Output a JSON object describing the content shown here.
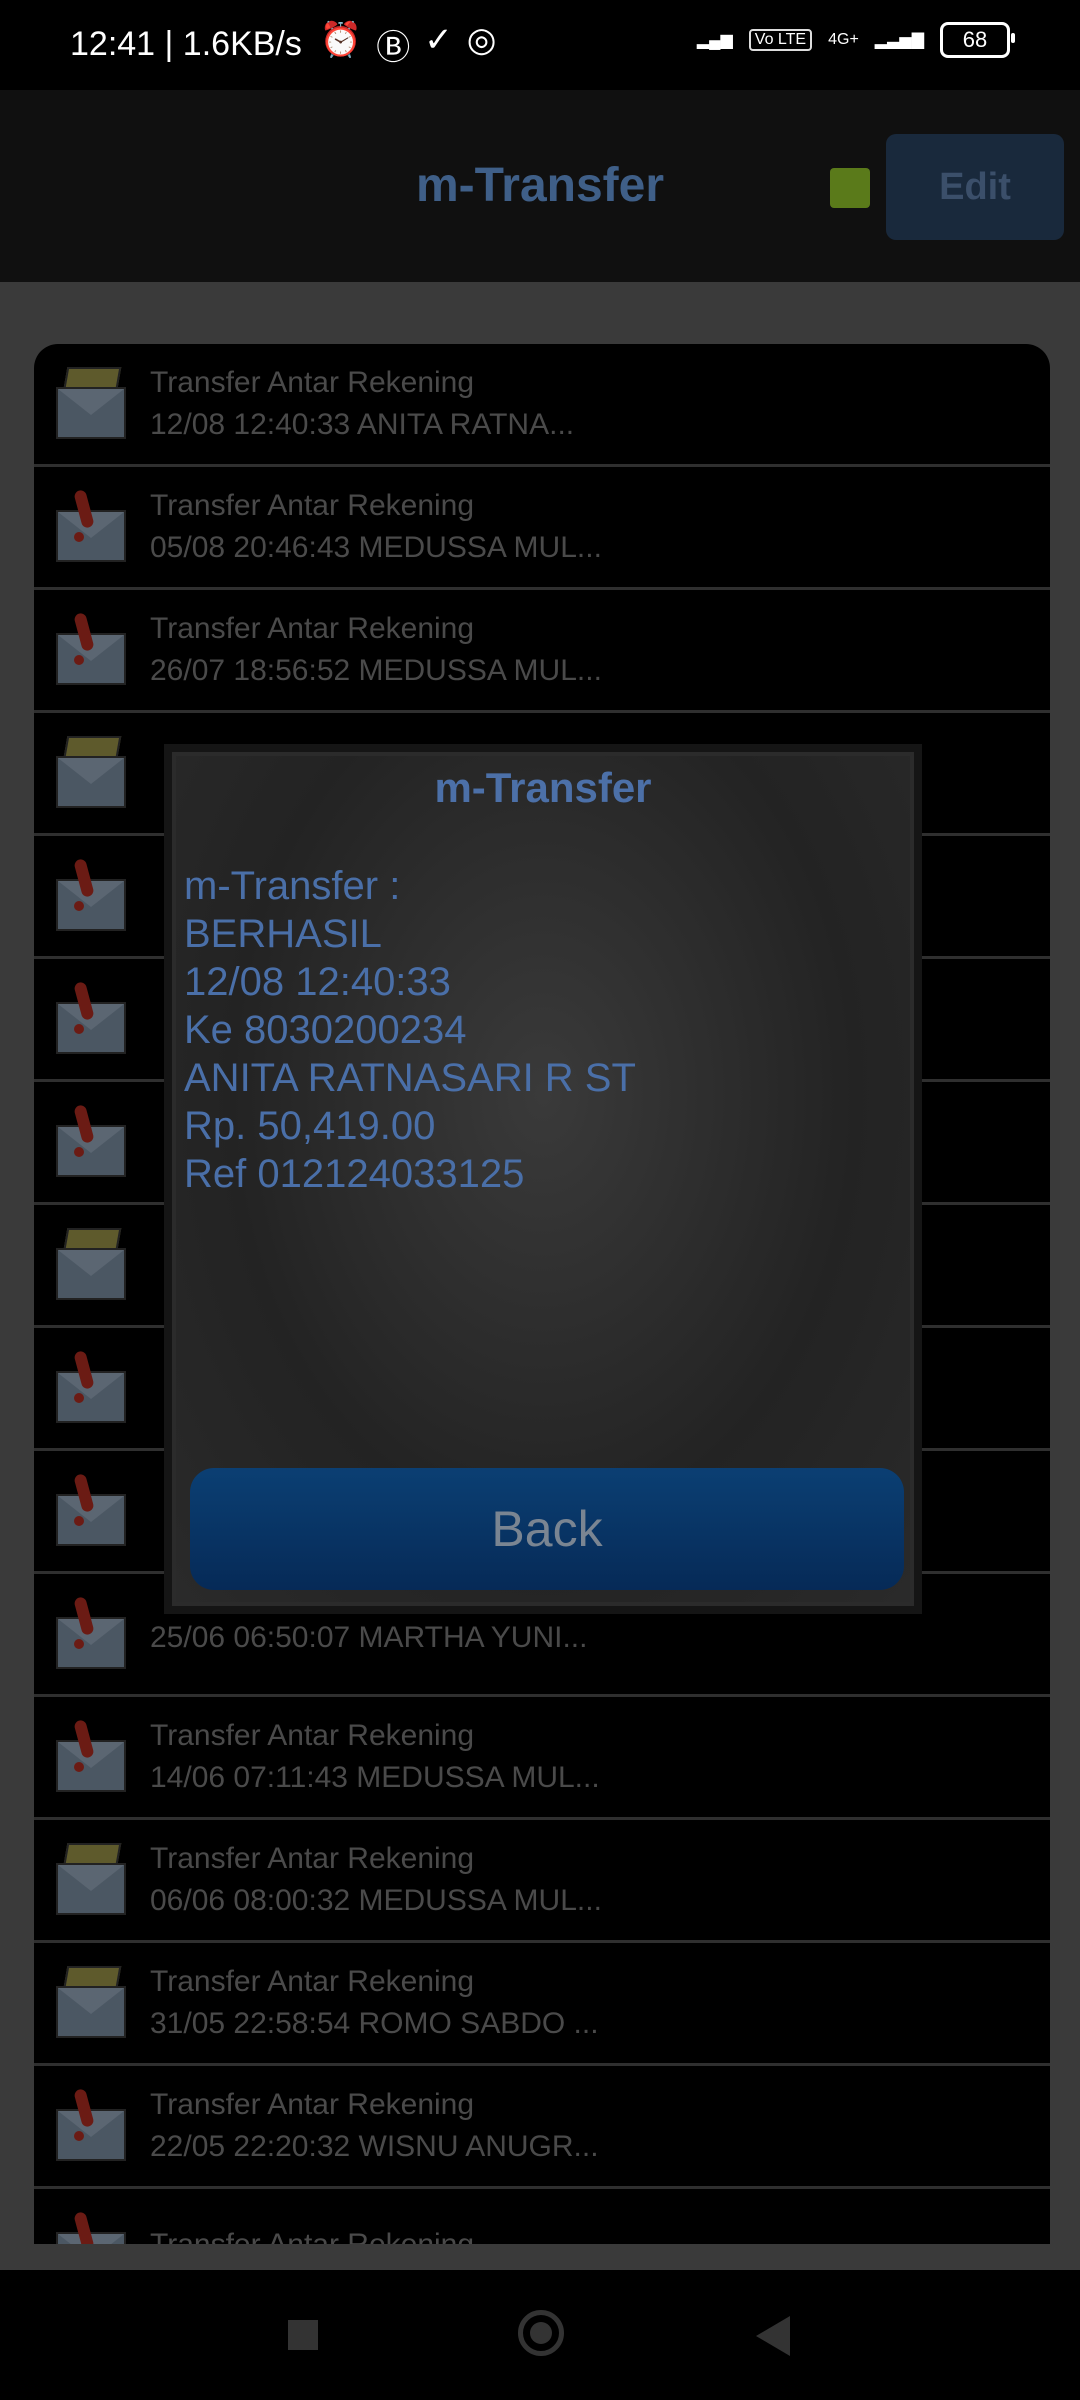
{
  "status_bar": {
    "time_speed": "12:41 | 1.6KB/s",
    "network_label": "4G+",
    "volte_label": "Vo LTE",
    "battery": "68"
  },
  "header": {
    "title": "m-Transfer",
    "edit_label": "Edit"
  },
  "list": {
    "items": [
      {
        "title": "Transfer Antar Rekening",
        "subtitle": "12/08 12:40:33 ANITA RATNA...",
        "icon": "open-envelope-icon"
      },
      {
        "title": "Transfer Antar Rekening",
        "subtitle": "05/08 20:46:43 MEDUSSA MUL...",
        "icon": "alert-envelope-icon"
      },
      {
        "title": "Transfer Antar Rekening",
        "subtitle": "26/07 18:56:52 MEDUSSA MUL...",
        "icon": "alert-envelope-icon"
      },
      {
        "title": "",
        "subtitle": "",
        "icon": "open-envelope-icon"
      },
      {
        "title": "",
        "subtitle": "",
        "icon": "alert-envelope-icon"
      },
      {
        "title": "",
        "subtitle": "",
        "icon": "alert-envelope-icon"
      },
      {
        "title": "",
        "subtitle": "",
        "icon": "alert-envelope-icon"
      },
      {
        "title": "",
        "subtitle": "",
        "icon": "open-envelope-icon"
      },
      {
        "title": "",
        "subtitle": "",
        "icon": "alert-envelope-icon"
      },
      {
        "title": "",
        "subtitle": "",
        "icon": "alert-envelope-icon"
      },
      {
        "title": "",
        "subtitle": "25/06 06:50:07 MARTHA YUNI...",
        "icon": "alert-envelope-icon"
      },
      {
        "title": "Transfer Antar Rekening",
        "subtitle": "14/06 07:11:43 MEDUSSA MUL...",
        "icon": "alert-envelope-icon"
      },
      {
        "title": "Transfer Antar Rekening",
        "subtitle": "06/06 08:00:32 MEDUSSA MUL...",
        "icon": "open-envelope-icon"
      },
      {
        "title": "Transfer Antar Rekening",
        "subtitle": "31/05 22:58:54 ROMO SABDO ...",
        "icon": "open-envelope-icon"
      },
      {
        "title": "Transfer Antar Rekening",
        "subtitle": "22/05 22:20:32 WISNU ANUGR...",
        "icon": "alert-envelope-icon"
      },
      {
        "title": "Transfer Antar Rekening",
        "subtitle": "",
        "icon": "alert-envelope-icon"
      }
    ]
  },
  "modal": {
    "title": "m-Transfer",
    "lines": [
      "m-Transfer :",
      "BERHASIL",
      "12/08 12:40:33",
      "Ke 8030200234",
      "ANITA RATNASARI R ST",
      "Rp. 50,419.00",
      "Ref 012124033125"
    ],
    "back_label": "Back"
  },
  "colors": {
    "accent": "#4c70a8",
    "button": "#0b3f73",
    "status_green": "#5a7a1a"
  }
}
